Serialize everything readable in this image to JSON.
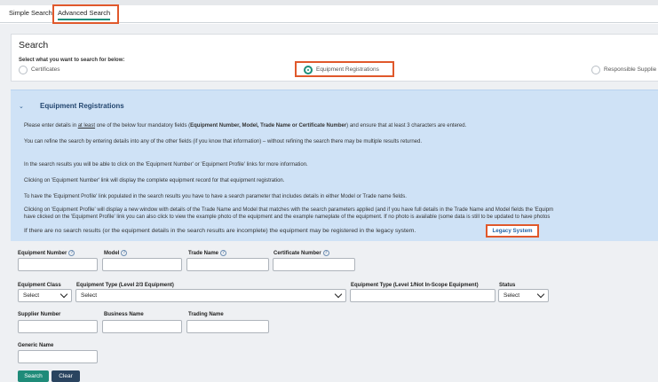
{
  "tabs": {
    "simple": "Simple Search",
    "advanced": "Advanced Search"
  },
  "search": {
    "title": "Search",
    "subtitle": "Select what you want to search for below:",
    "options": [
      "Certificates",
      "Equipment Registrations",
      "Responsible Supplie"
    ],
    "selected": "Equipment Registrations"
  },
  "info": {
    "title": "Equipment Registrations",
    "line1_pre": "Please enter details in ",
    "line1_u": "at least",
    "line1_mid": " one of the below four mandatory fields (",
    "line1_bold": "Equipment Number, Model, Trade Name or Certificate Number",
    "line1_post": ") and ensure that at least 3 characters are entered.",
    "line2": "You can refine the search by entering details into any of the other fields (if you know that information) – without refining the search there may be multiple results returned.",
    "line3": "In the search results you will be able to click on the 'Equipment Number' or 'Equipment Profile' links for more information.",
    "line4": "Clicking on 'Equipment Number' link will display the complete equipment record for that equipment registration.",
    "line5": "To have the 'Equipment Profile' link populated in the search results you have to have a search parameter that includes details in either Model or Trade name fields.",
    "line6": "Clicking on 'Equipment Profile' will display a new window with details of the Trade Name and Model that matches with the search parameters applied (and if you have full details in the Trade Name and Model fields the 'Equipm",
    "line7": "have clicked on the 'Equipment Profile' link you can also click to view the example photo of the equipment and the example nameplate of the equipment. If no photo is available (some data is still to be updated to have photos",
    "line8": "If there are no search results (or the equipment details in the search results are incomplete) the equipment may be registered in the legacy system.",
    "legacy_button": "Legacy System"
  },
  "fields": {
    "equipment_number": "Equipment Number",
    "model": "Model",
    "trade_name": "Trade Name",
    "certificate_number": "Certificate Number",
    "equipment_class": "Equipment Class",
    "equipment_type_23": "Equipment Type (Level 2/3 Equipment)",
    "equipment_type_1": "Equipment Type (Level 1/Not In-Scope Equipment)",
    "status": "Status",
    "supplier_number": "Supplier Number",
    "business_name": "Business Name",
    "trading_name": "Trading Name",
    "generic_name": "Generic Name",
    "select_placeholder": "Select",
    "help_glyph": "?"
  },
  "buttons": {
    "search": "Search",
    "clear": "Clear"
  },
  "colors": {
    "accent": "#1d8f7a",
    "highlight": "#e0582b",
    "info_bg": "#cfe2f6",
    "link": "#2365a8"
  }
}
